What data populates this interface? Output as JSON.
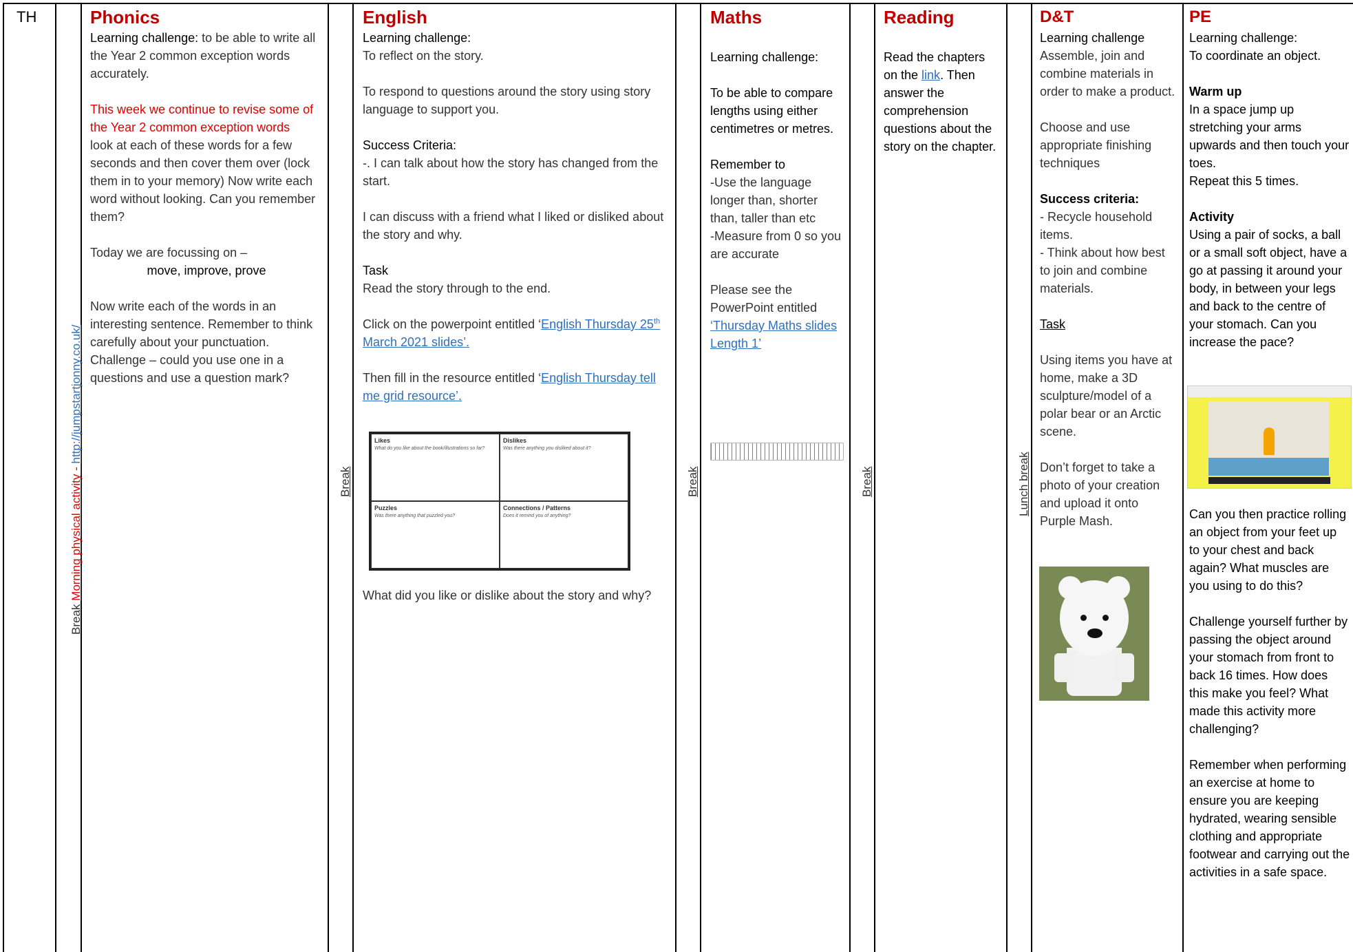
{
  "row_label": "TH",
  "break_label": "Break",
  "lunch_break_label": "Lunch break",
  "morning_activity": {
    "prefix": "Break",
    "label": "Morning physical activity - ",
    "url": "http://jumpstartjonny.co.uk/"
  },
  "phonics": {
    "title": "Phonics",
    "challenge_label": "Learning challenge:",
    "challenge_text": "to be able to write all the Year 2 common exception words accurately.",
    "red_note": "This week we continue to revise some of the Year 2 common exception words",
    "instructions": "look at each of these words for a few seconds and then cover them over (lock them in to your memory) Now write each word without looking. Can you remember them?",
    "focus_intro": "Today we are focussing on –",
    "focus_words": "move, improve, prove",
    "sentence_task": "Now write each of the words in an interesting sentence. Remember to think carefully about your punctuation.",
    "challenge_extra": "Challenge – could you use one in a questions and use a question mark?"
  },
  "english": {
    "title": "English",
    "challenge_label": "Learning challenge:",
    "challenge_1": "To reflect on the story.",
    "challenge_2": "To respond to questions around the story using story language to support you.",
    "success_label": "Success Criteria:",
    "success_1": "-. I can talk about how the story has changed from the start.",
    "success_2": "I can discuss with a friend what I liked or disliked about the story and why.",
    "task_label": "Task",
    "task_1": "Read the story through to the end.",
    "task_2_prefix": "Click on the powerpoint entitled ‘",
    "task_2_link_a": "English Thursday 25",
    "task_2_link_sup": "th",
    "task_2_link_b": " March 2021 slides’.",
    "task_3_prefix": "Then fill in the resource entitled ‘",
    "task_3_link": "English Thursday tell me grid resource’.",
    "grid": {
      "likes_title": "Likes",
      "likes_q": "What do you like about the book/illustrations so far?",
      "dislikes_title": "Dislikes",
      "dislikes_q": "Was there anything you disliked about it?",
      "puzzles_title": "Puzzles",
      "puzzles_q": "Was there anything that puzzled you?",
      "connections_title": "Connections / Patterns",
      "connections_q": "Does it remind you of anything?"
    },
    "closing_question": "What did you like or dislike about the story and why?"
  },
  "maths": {
    "title": "Maths",
    "challenge_label": "Learning challenge:",
    "challenge_text": "To be able to compare lengths using either centimetres or metres.",
    "remember_label": "Remember to",
    "remember_1": "-Use the language longer than, shorter than, taller than etc",
    "remember_2": "-Measure from 0 so you are accurate",
    "see_prefix": "Please see the PowerPoint entitled ",
    "see_link": "‘Thursday Maths slides Length 1’"
  },
  "reading": {
    "title": "Reading",
    "text_a": "Read the chapters on the ",
    "link": "link",
    "text_b": ". Then answer the comprehension questions about the story on the chapter."
  },
  "dt": {
    "title": "D&T",
    "challenge_label": "Learning challenge",
    "challenge_1": "Assemble, join and combine materials in order to make a product.",
    "challenge_2": "Choose and use appropriate finishing techniques",
    "success_label": "Success criteria:",
    "success_1": "- Recycle household items.",
    "success_2": "- Think about how best to join and combine materials.",
    "task_label": "Task",
    "task_1": "Using items you have at home, make a 3D sculpture/model of a polar bear or an Arctic scene.",
    "task_2": "Don’t forget to take a photo of your creation and upload it onto Purple Mash."
  },
  "pe": {
    "title": "PE",
    "challenge_label": "Learning challenge:",
    "challenge_text": "To coordinate an object.",
    "warmup_label": "Warm up",
    "warmup_text": "In a space jump up stretching your arms upwards and then touch your toes.",
    "warmup_repeat": "Repeat this 5 times.",
    "activity_label": "Activity",
    "activity_text": "Using a pair of socks, a ball or a small soft object, have a go at passing it around your body, in between your legs and back to the centre of your stomach. Can you increase the pace?",
    "practice_text": "Can you then practice rolling an object from your feet up to your chest and back again? What muscles are you using to do this?",
    "challenge_extra": "Challenge yourself further by passing the object around your stomach from front to back 16 times. How does this make you feel? What made this activity more challenging?",
    "remember_text": "Remember when performing an exercise at home to ensure you are keeping hydrated, wearing sensible clothing and appropriate footwear and carrying out the activities in a safe space."
  }
}
